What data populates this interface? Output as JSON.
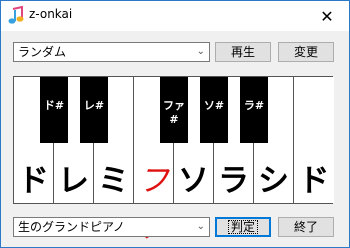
{
  "window": {
    "title": "z-onkai",
    "close_glyph": "✕",
    "icon": "music-note-icon"
  },
  "mode_select": {
    "value": "ランダム"
  },
  "buttons": {
    "play": "再生",
    "change": "変更",
    "judge": "判定",
    "quit": "終了"
  },
  "instrument_select": {
    "value": "生のグランドピアノ"
  },
  "keyboard": {
    "white_keys": [
      "ド",
      "レ",
      "ミ",
      "ファ",
      "ソ",
      "ラ",
      "シ",
      "ド"
    ],
    "highlighted_key": "ファ",
    "highlight_color": "#e01010",
    "black_keys": [
      "ド#",
      "レ#",
      "ファ#",
      "ソ#",
      "ラ#"
    ]
  }
}
